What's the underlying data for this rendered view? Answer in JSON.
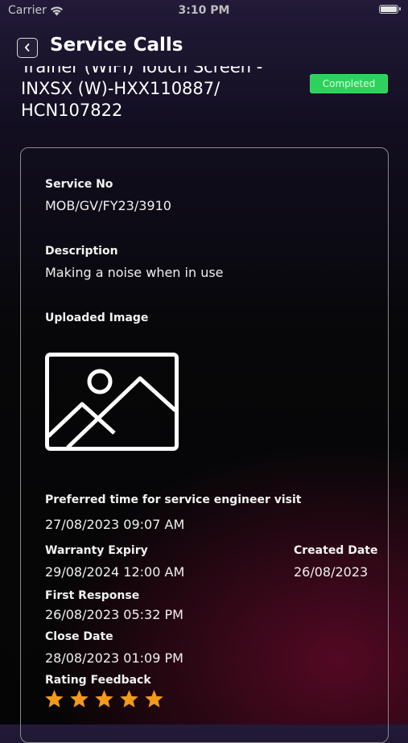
{
  "status_bar": {
    "carrier": "Carrier",
    "time": "3:10 PM"
  },
  "header": {
    "title": "Service Calls"
  },
  "product": {
    "title_lines": [
      "Trainer (WIFI) Touch Screen -",
      "INXSX (W)-HXX110887/",
      "HCN107822"
    ],
    "status": "Completed"
  },
  "details": {
    "service_no_label": "Service No",
    "service_no": "MOB/GV/FY23/3910",
    "description_label": "Description",
    "description": "Making a noise when in use",
    "uploaded_image_label": "Uploaded Image",
    "preferred_time_label": "Preferred time for service engineer visit",
    "preferred_time": "27/08/2023 09:07 AM",
    "warranty_expiry_label": "Warranty Expiry",
    "warranty_expiry": "29/08/2024 12:00 AM",
    "created_date_label": "Created Date",
    "created_date": "26/08/2023",
    "first_response_label": "First Response",
    "first_response": "26/08/2023 05:32 PM",
    "close_date_label": "Close Date",
    "close_date": "28/08/2023 01:09 PM",
    "rating_label": "Rating Feedback",
    "rating": 5,
    "rating_max": 5
  },
  "colors": {
    "star": "#f29a1a",
    "badge": "#2ed15c",
    "card_border": "#8a8a8a"
  }
}
